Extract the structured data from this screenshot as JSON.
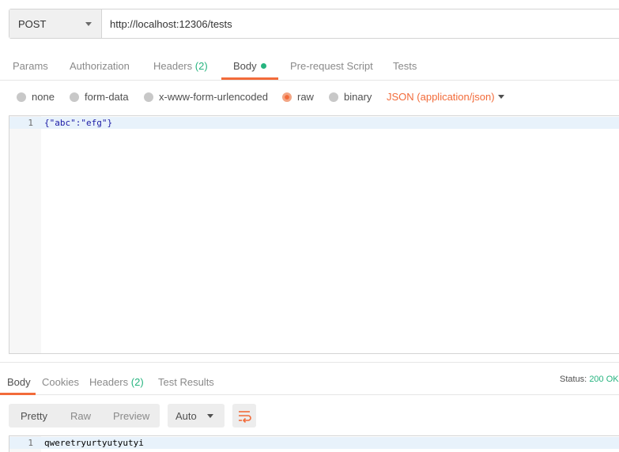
{
  "request": {
    "method": "POST",
    "url": "http://localhost:12306/tests"
  },
  "request_tabs": {
    "params": "Params",
    "authorization": "Authorization",
    "headers": "Headers",
    "headers_count": "(2)",
    "body": "Body",
    "prerequest": "Pre-request Script",
    "tests": "Tests"
  },
  "body_types": {
    "none": "none",
    "form_data": "form-data",
    "urlencoded": "x-www-form-urlencoded",
    "raw": "raw",
    "binary": "binary",
    "selected": "raw",
    "content_type": "JSON (application/json)"
  },
  "editor": {
    "line_number": "1",
    "code": "{\"abc\":\"efg\"}"
  },
  "response_tabs": {
    "body": "Body",
    "cookies": "Cookies",
    "headers": "Headers",
    "headers_count": "(2)",
    "test_results": "Test Results"
  },
  "status": {
    "label": "Status:",
    "value": "200 OK"
  },
  "response_toolbar": {
    "pretty": "Pretty",
    "raw": "Raw",
    "preview": "Preview",
    "format": "Auto"
  },
  "response_body": {
    "line_number": "1",
    "text": "qweretryurtyutyutyi"
  },
  "colors": {
    "accent": "#f26b3a",
    "success": "#26b47f",
    "code_string": "#1a1aa6"
  }
}
